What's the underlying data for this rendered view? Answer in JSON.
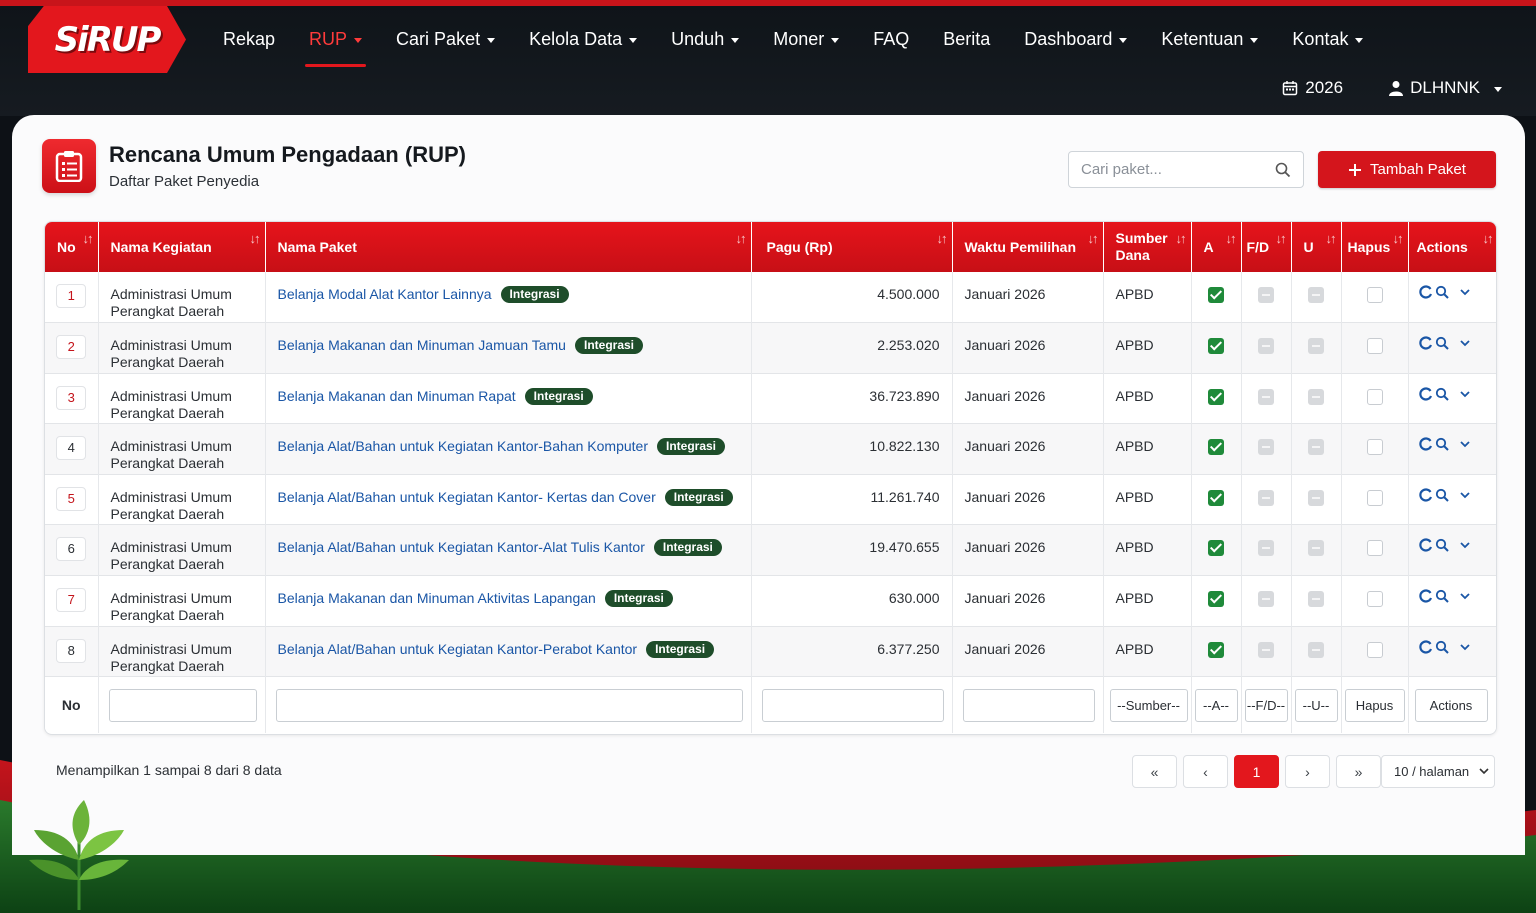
{
  "brand": {
    "logo_text": "SiRUP"
  },
  "nav": {
    "items": [
      {
        "label": "Rekap",
        "dropdown": false,
        "active": false
      },
      {
        "label": "RUP",
        "dropdown": true,
        "active": true
      },
      {
        "label": "Cari Paket",
        "dropdown": true,
        "active": false
      },
      {
        "label": "Kelola Data",
        "dropdown": true,
        "active": false
      },
      {
        "label": "Unduh",
        "dropdown": true,
        "active": false
      },
      {
        "label": "Moner",
        "dropdown": true,
        "active": false
      },
      {
        "label": "FAQ",
        "dropdown": false,
        "active": false
      },
      {
        "label": "Berita",
        "dropdown": false,
        "active": false
      },
      {
        "label": "Dashboard",
        "dropdown": true,
        "active": false
      },
      {
        "label": "Ketentuan",
        "dropdown": true,
        "active": false
      },
      {
        "label": "Kontak",
        "dropdown": true,
        "active": false
      }
    ],
    "year": "2026",
    "user": "DLHNNK"
  },
  "page": {
    "title": "Rencana Umum Pengadaan (RUP)",
    "subtitle": "Daftar Paket Penyedia",
    "search_placeholder": "Cari paket...",
    "add_button": "Tambah Paket"
  },
  "table": {
    "headers": {
      "no": "No",
      "kegiatan": "Nama Kegiatan",
      "paket": "Nama Paket",
      "pagu": "Pagu (Rp)",
      "waktu": "Waktu Pemilihan",
      "sumber": "Sumber Dana",
      "a": "A",
      "fd": "F/D",
      "u": "U",
      "hapus": "Hapus",
      "actions": "Actions"
    },
    "badge_label": "Integrasi",
    "rows": [
      {
        "no": "1",
        "kegiatan_1": "Administrasi Umum",
        "kegiatan_2": "Perangkat Daerah",
        "paket": "Belanja Modal Alat Kantor Lainnya",
        "pagu": "4.500.000",
        "waktu": "Januari 2026",
        "sumber": "APBD"
      },
      {
        "no": "2",
        "kegiatan_1": "Administrasi Umum",
        "kegiatan_2": "Perangkat Daerah",
        "paket": "Belanja Makanan dan Minuman Jamuan Tamu",
        "pagu": "2.253.020",
        "waktu": "Januari 2026",
        "sumber": "APBD"
      },
      {
        "no": "3",
        "kegiatan_1": "Administrasi Umum",
        "kegiatan_2": "Perangkat Daerah",
        "paket": "Belanja Makanan dan Minuman Rapat",
        "pagu": "36.723.890",
        "waktu": "Januari 2026",
        "sumber": "APBD"
      },
      {
        "no": "4",
        "kegiatan_1": "Administrasi Umum",
        "kegiatan_2": "Perangkat Daerah",
        "paket": "Belanja Alat/Bahan untuk Kegiatan Kantor-Bahan Komputer",
        "pagu": "10.822.130",
        "waktu": "Januari 2026",
        "sumber": "APBD"
      },
      {
        "no": "5",
        "kegiatan_1": "Administrasi Umum",
        "kegiatan_2": "Perangkat Daerah",
        "paket": "Belanja Alat/Bahan untuk Kegiatan Kantor- Kertas dan Cover",
        "pagu": "11.261.740",
        "waktu": "Januari 2026",
        "sumber": "APBD"
      },
      {
        "no": "6",
        "kegiatan_1": "Administrasi Umum",
        "kegiatan_2": "Perangkat Daerah",
        "paket": "Belanja Alat/Bahan untuk Kegiatan Kantor-Alat Tulis Kantor",
        "pagu": "19.470.655",
        "waktu": "Januari 2026",
        "sumber": "APBD"
      },
      {
        "no": "7",
        "kegiatan_1": "Administrasi Umum",
        "kegiatan_2": "Perangkat Daerah",
        "paket": "Belanja Makanan dan Minuman Aktivitas Lapangan",
        "pagu": "630.000",
        "waktu": "Januari 2026",
        "sumber": "APBD"
      },
      {
        "no": "8",
        "kegiatan_1": "Administrasi Umum",
        "kegiatan_2": "Perangkat Daerah",
        "paket": "Belanja Alat/Bahan untuk Kegiatan Kantor-Perabot Kantor",
        "pagu": "6.377.250",
        "waktu": "Januari 2026",
        "sumber": "APBD"
      }
    ],
    "filters": {
      "no": "No",
      "sumber": "--Sumber--",
      "a": "--A--",
      "fd": "--F/D--",
      "u": "--U--",
      "hapus": "Hapus",
      "actions": "Actions"
    }
  },
  "footer": {
    "info": "Menampilkan 1 sampai 8 dari 8 data",
    "pager": {
      "first": "«",
      "prev": "‹",
      "current": "1",
      "next": "›",
      "last": "»"
    },
    "per_page": "10 / halaman"
  },
  "colors": {
    "brand_red": "#e3171d",
    "header_red": "#d4151c",
    "link_blue": "#1a56a6",
    "badge_green": "#1e4d2a",
    "check_green": "#1f8a3a"
  }
}
